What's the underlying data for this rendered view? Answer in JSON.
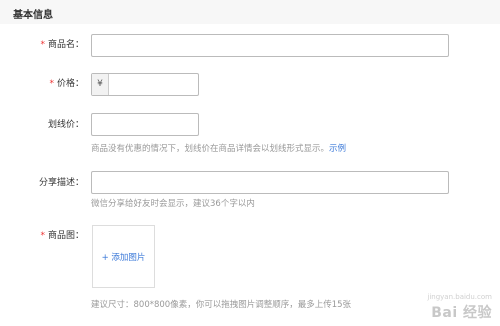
{
  "section": {
    "title": "基本信息"
  },
  "fields": {
    "product_name": {
      "required": "*",
      "label": "商品名：",
      "value": ""
    },
    "price": {
      "required": "*",
      "label": "价格：",
      "prefix": "¥",
      "value": ""
    },
    "strike_price": {
      "label": "划线价：",
      "value": "",
      "help": "商品没有优惠的情况下，划线价在商品详情会以划线形式显示。",
      "help_link": "示例"
    },
    "share_desc": {
      "label": "分享描述：",
      "value": "",
      "help": "微信分享给好友时会显示，建议36个字以内"
    },
    "product_image": {
      "required": "*",
      "label": "商品图：",
      "add_label": "+ 添加图片",
      "help": "建议尺寸：800*800像素，你可以拖拽图片调整顺序，最多上传15张"
    }
  },
  "watermark": {
    "brand": "Bai 经验",
    "url": "jingyan.baidu.com"
  }
}
